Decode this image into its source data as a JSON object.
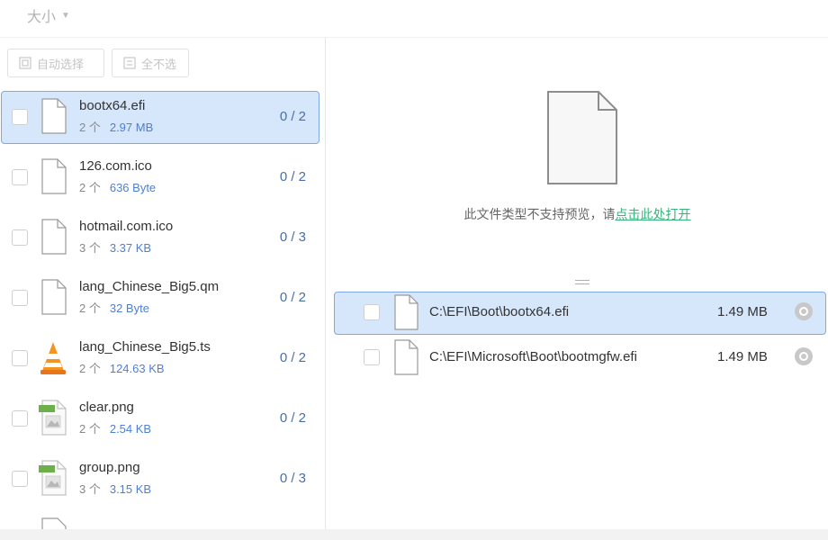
{
  "sort": {
    "label": "大小",
    "caret_icon": "caret-down-icon"
  },
  "actions": {
    "auto_select": "自动选择",
    "select_none": "全不选"
  },
  "files": [
    {
      "name": "bootx64.efi",
      "count": "2 个",
      "size": "2.97 MB",
      "ratio": "0 / 2",
      "icon": "blank-file-icon",
      "selected": true
    },
    {
      "name": "126.com.ico",
      "count": "2 个",
      "size": "636 Byte",
      "ratio": "0 / 2",
      "icon": "blank-file-icon"
    },
    {
      "name": "hotmail.com.ico",
      "count": "3 个",
      "size": "3.37 KB",
      "ratio": "0 / 3",
      "icon": "blank-file-icon"
    },
    {
      "name": "lang_Chinese_Big5.qm",
      "count": "2 个",
      "size": "32 Byte",
      "ratio": "0 / 2",
      "icon": "blank-file-icon"
    },
    {
      "name": "lang_Chinese_Big5.ts",
      "count": "2 个",
      "size": "124.63 KB",
      "ratio": "0 / 2",
      "icon": "vlc-cone-icon"
    },
    {
      "name": "clear.png",
      "count": "2 个",
      "size": "2.54 KB",
      "ratio": "0 / 2",
      "icon": "image-file-icon"
    },
    {
      "name": "group.png",
      "count": "3 个",
      "size": "3.15 KB",
      "ratio": "0 / 3",
      "icon": "image-file-icon"
    }
  ],
  "preview": {
    "message": "此文件类型不支持预览，请",
    "open_link": "点击此处打开"
  },
  "paths": [
    {
      "path": "C:\\EFI\\Boot\\bootx64.efi",
      "size": "1.49 MB",
      "selected": true
    },
    {
      "path": "C:\\EFI\\Microsoft\\Boot\\bootmgfw.efi",
      "size": "1.49 MB"
    }
  ],
  "colors": {
    "selection_bg": "#d6e6fb",
    "selection_border": "#7ea9e8",
    "size_text": "#4f7fd0",
    "link": "#39b27c"
  }
}
